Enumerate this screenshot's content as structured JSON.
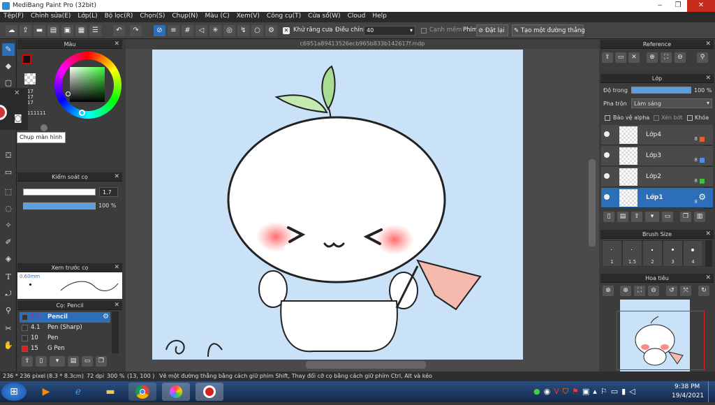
{
  "app": {
    "title": "MediBang Paint Pro (32bit)"
  },
  "window_controls": {
    "minimize": "‒",
    "maximize": "❐",
    "close": "✕"
  },
  "menu": [
    "Tệp(F)",
    "Chỉnh sửa(E)",
    "Lớp(L)",
    "Bộ lọc(R)",
    "Chọn(S)",
    "Chụp(N)",
    "Màu (C)",
    "Xem(V)",
    "Công cụ(T)",
    "Cửa sổ(W)",
    "Cloud",
    "Help"
  ],
  "toolbar": {
    "antialias_label": "Khử răng cưa",
    "adjust_label": "Điều chỉnh",
    "adjust_value": "40",
    "snap_label": "Cạnh mềm",
    "pen_label": "Phím",
    "reset_label": "Đặt lại",
    "create_line_label": "Tạo một đường thẳng"
  },
  "doc": {
    "filename": "c6951a89413526ecb965b833b142617f.mdp"
  },
  "panels": {
    "color": {
      "title": "Màu",
      "values": [
        "17",
        "17",
        "17"
      ],
      "hex": "111111",
      "primary": "#111111"
    },
    "capture_popup": {
      "tooltip": "Chụp màn hình"
    },
    "brush_control": {
      "title": "Kiểm soát cọ",
      "size": "1.7",
      "opacity": "100 %"
    },
    "brush_preview": {
      "title": "Xem trước cọ",
      "size_label": "0.60mm"
    },
    "brush_list": {
      "title": "Cọ: Pencil",
      "items": [
        {
          "value": "1.7",
          "name": "Pencil",
          "color": "#333333",
          "selected": true
        },
        {
          "value": "4.1",
          "name": "Pen (Sharp)",
          "color": "#333333",
          "selected": false
        },
        {
          "value": "10",
          "name": "Pen",
          "color": "#333333",
          "selected": false
        },
        {
          "value": "15",
          "name": "G Pen",
          "color": "#d82020",
          "selected": false
        }
      ]
    },
    "reference": {
      "title": "Reference"
    },
    "layer": {
      "title": "Lớp",
      "opacity_label": "Độ trong",
      "opacity_value": "100 %",
      "blend_label": "Pha trộn",
      "blend_value": "Làm sáng",
      "protect_alpha": "Bảo vệ alpha",
      "clipping": "Xén bớt",
      "lock": "Khóa",
      "layers": [
        {
          "name": "Lớp4",
          "bits": "8",
          "tag": "#e06030",
          "selected": false
        },
        {
          "name": "Lớp3",
          "bits": "8",
          "tag": "#4a90e0",
          "selected": false
        },
        {
          "name": "Lớp2",
          "bits": "8",
          "tag": "#40c040",
          "selected": false
        },
        {
          "name": "Lớp1",
          "bits": "8",
          "tag": "",
          "selected": true
        }
      ]
    },
    "brush_size": {
      "title": "Brush Size",
      "sizes": [
        "1",
        "1.5",
        "2",
        "3",
        "4"
      ]
    },
    "navigator": {
      "title": "Hoa tiêu"
    }
  },
  "status": {
    "size": "236 * 236 pixel",
    "dims": "(8.3 * 8.3cm)",
    "dpi": "72 dpi",
    "zoom": "300 %",
    "coords": "(13, 100 )",
    "hint": "Vẽ một đường thẳng bằng cách giữ phím Shift, Thay đổi cỡ cọ bằng cách giữ phím Ctrl, Alt và kéo"
  },
  "taskbar": {
    "time": "9:38 PM",
    "date": "19/4/2021"
  }
}
